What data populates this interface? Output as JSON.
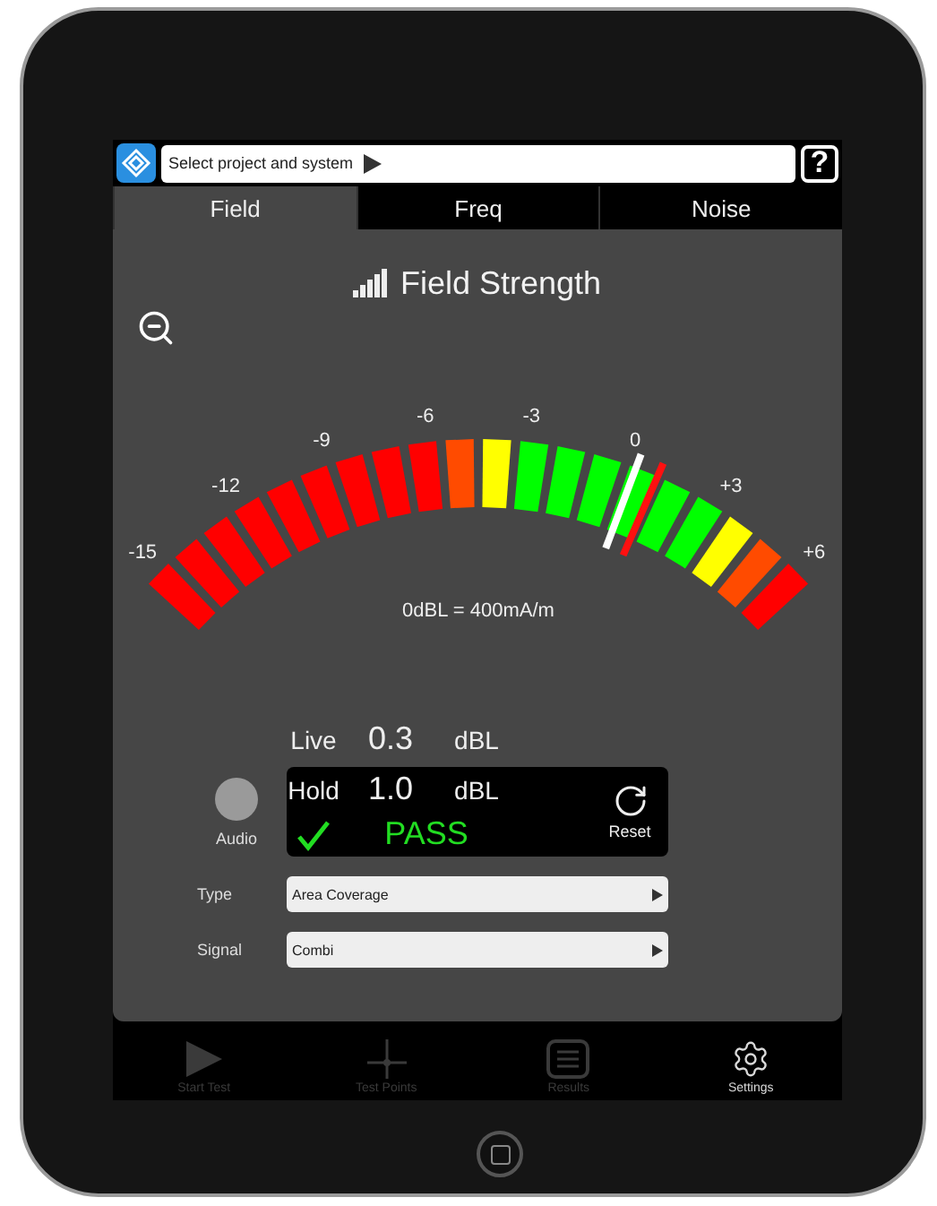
{
  "top_bar": {
    "project_selector": "Select project and system",
    "help": "?"
  },
  "tabs": [
    {
      "label": "Field",
      "selected": true
    },
    {
      "label": "Freq",
      "selected": false
    },
    {
      "label": "Noise",
      "selected": false
    }
  ],
  "title": "Field Strength",
  "gauge": {
    "scale": [
      "-15",
      "-12",
      "-9",
      "-6",
      "-3",
      "0",
      "+3",
      "+6"
    ],
    "segments": [
      {
        "color": "#ff0000"
      },
      {
        "color": "#ff0000"
      },
      {
        "color": "#ff0000"
      },
      {
        "color": "#ff0000"
      },
      {
        "color": "#ff0000"
      },
      {
        "color": "#ff0000"
      },
      {
        "color": "#ff0000"
      },
      {
        "color": "#ff0000"
      },
      {
        "color": "#ff0000"
      },
      {
        "color": "#ff4b00"
      },
      {
        "color": "#ffff00"
      },
      {
        "color": "#00ff00"
      },
      {
        "color": "#00ff00"
      },
      {
        "color": "#00ff00"
      },
      {
        "color": "#00ff00"
      },
      {
        "color": "#00ff00"
      },
      {
        "color": "#00ff00"
      },
      {
        "color": "#ffff00"
      },
      {
        "color": "#ff4b00"
      },
      {
        "color": "#ff0000"
      }
    ],
    "live_needle": {
      "level": 0.729
    },
    "hold_needle": {
      "level": 0.762
    },
    "reference": "0dBL = 400mA/m"
  },
  "live": {
    "label": "Live",
    "value": "0.3",
    "unit": "dBL"
  },
  "audio": {
    "label": "Audio",
    "on": false
  },
  "hold": {
    "label": "Hold",
    "value": "1.0",
    "unit": "dBL",
    "passed": true,
    "status": "PASS",
    "reset": "Reset"
  },
  "settings_rows": [
    {
      "label": "Type",
      "value": "Area Coverage"
    },
    {
      "label": "Signal",
      "value": "Combi"
    }
  ],
  "tab_bar": [
    {
      "kind": "play",
      "label": "Start Test",
      "selected": false
    },
    {
      "kind": "crosshair",
      "label": "Test Points",
      "selected": false
    },
    {
      "kind": "list",
      "label": "Results",
      "selected": false
    },
    {
      "kind": "gear",
      "label": "Settings",
      "selected": true
    }
  ]
}
